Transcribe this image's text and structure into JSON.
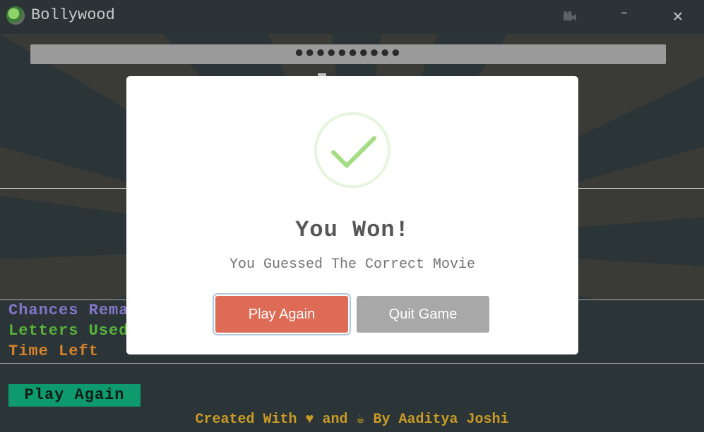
{
  "window": {
    "title": "Bollywood",
    "icons": {
      "logo": "app-logo-icon",
      "camera": "camera-icon",
      "minimize": "minimize-icon",
      "close": "close-icon"
    },
    "minimize_glyph": "–",
    "close_glyph": "✕"
  },
  "game": {
    "masked_word": "●●●●●●●●●●",
    "stats": [
      "Chances Remaining",
      "Letters Used",
      "Time Left"
    ],
    "play_again_label": "Play Again",
    "credit": "Created With ♥ and ☕ By Aaditya Joshi"
  },
  "modal": {
    "icon": "success-check-icon",
    "title": "You Won!",
    "text": "You Guessed The Correct Movie",
    "confirm_label": "Play Again",
    "cancel_label": "Quit Game",
    "colors": {
      "confirm": "#dd6b55",
      "cancel": "#a8a8a8",
      "check": "#a5dc86"
    }
  }
}
